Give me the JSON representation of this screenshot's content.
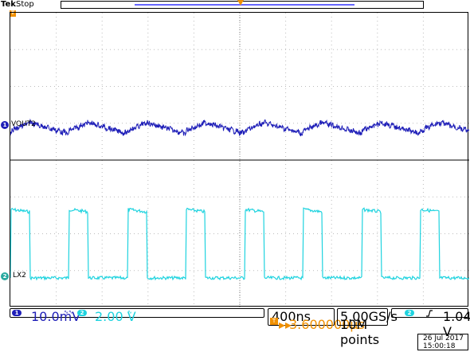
{
  "header": {
    "brand": "Tek",
    "run_state": "Stop",
    "trigger_marker": "T"
  },
  "channels": [
    {
      "id": "1",
      "label": "VOUT2",
      "color": "#1f1fb8",
      "scale": "10.0mV",
      "coupling": "∿∿"
    },
    {
      "id": "2",
      "label": "LX2",
      "color": "#1fd3df",
      "scale": "2.00 V",
      "coupling": "∿"
    }
  ],
  "horizontal": {
    "timebase": "400ns",
    "trigger_icon": "T",
    "delay": "3.600000µs"
  },
  "acquisition": {
    "sample_rate": "5.00GS/s",
    "record_length": "10M points"
  },
  "trigger": {
    "source_badge": "2",
    "slope_icon": "rising-edge-icon",
    "level": "1.04 V"
  },
  "datetime": {
    "date": "26 Jul  2017",
    "time": "15:00:18"
  }
}
